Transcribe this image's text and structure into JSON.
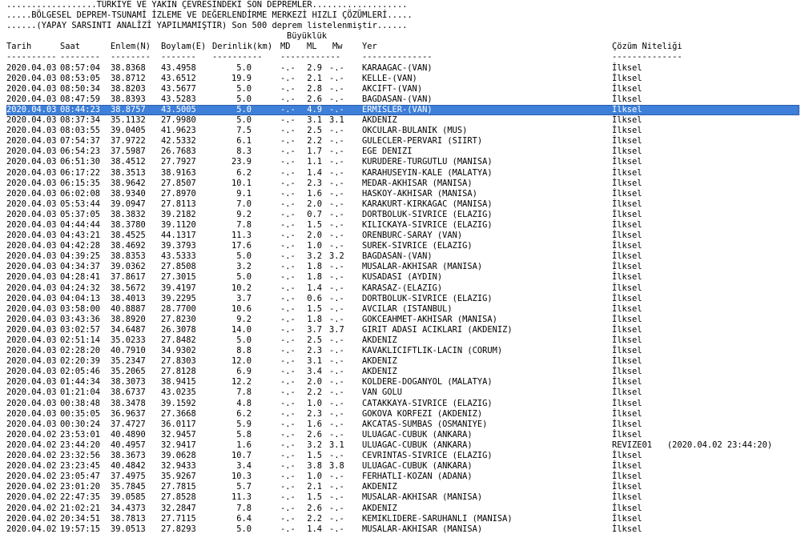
{
  "header": {
    "line1": "..................TÜRKİYE VE YAKIN ÇEVRESİNDEKİ SON DEPREMLER...................",
    "line2": ".....BÖLGESEL DEPREM-TSUNAMİ İZLEME VE DEĞERLENDİRME MERKEZİ HIZLI ÇÖZÜMLERİ.....",
    "line3": "......(YAPAY SARSINTI ANALİZİ YAPILMAMIŞTIR) Son 500 deprem listelenmiştir......",
    "magnitude_group": "Büyüklük"
  },
  "columns": {
    "date": "Tarih",
    "time": "Saat",
    "lat": "Enlem(N)",
    "lon": "Boylam(E)",
    "depth": "Derinlik(km)",
    "md": "MD",
    "ml": "ML",
    "mw": "Mw",
    "place": "Yer",
    "solution": "Çözüm Niteliği"
  },
  "rulers": {
    "date": "----------",
    "time": "--------",
    "lat": "--------",
    "lon": "-------",
    "depth": "----------",
    "mag": "------------",
    "place": "--------------",
    "solution": "--------------"
  },
  "rows": [
    {
      "date": "2020.04.03",
      "time": "08:57:04",
      "lat": "38.8368",
      "lon": "43.4958",
      "depth": "5.0",
      "md": "-.-",
      "ml": "2.9",
      "mw": "-.-",
      "place": "KARAAGAC-(VAN)",
      "solution": "İlksel"
    },
    {
      "date": "2020.04.03",
      "time": "08:53:05",
      "lat": "38.8712",
      "lon": "43.6512",
      "depth": "19.9",
      "md": "-.-",
      "ml": "2.1",
      "mw": "-.-",
      "place": "KELLE-(VAN)",
      "solution": "İlksel"
    },
    {
      "date": "2020.04.03",
      "time": "08:50:34",
      "lat": "38.8203",
      "lon": "43.5677",
      "depth": "5.0",
      "md": "-.-",
      "ml": "2.8",
      "mw": "-.-",
      "place": "AKCIFT-(VAN)",
      "solution": "İlksel"
    },
    {
      "date": "2020.04.03",
      "time": "08:47:59",
      "lat": "38.8393",
      "lon": "43.5283",
      "depth": "5.0",
      "md": "-.-",
      "ml": "2.6",
      "mw": "-.-",
      "place": "BAGDASAN-(VAN)",
      "solution": "İlksel"
    },
    {
      "date": "2020.04.03",
      "time": "08:44:23",
      "lat": "38.8757",
      "lon": "43.5005",
      "depth": "5.0",
      "md": "-.-",
      "ml": "4.9",
      "mw": "-.-",
      "place": "ERMISLER-(VAN)",
      "solution": "İlksel",
      "selected": true
    },
    {
      "date": "2020.04.03",
      "time": "08:37:34",
      "lat": "35.1132",
      "lon": "27.9980",
      "depth": "5.0",
      "md": "-.-",
      "ml": "3.1",
      "mw": "3.1",
      "place": "AKDENIZ",
      "solution": "İlksel"
    },
    {
      "date": "2020.04.03",
      "time": "08:03:55",
      "lat": "39.0405",
      "lon": "41.9623",
      "depth": "7.5",
      "md": "-.-",
      "ml": "2.5",
      "mw": "-.-",
      "place": "OKCULAR-BULANIK (MUS)",
      "solution": "İlksel"
    },
    {
      "date": "2020.04.03",
      "time": "07:54:37",
      "lat": "37.9722",
      "lon": "42.5332",
      "depth": "6.1",
      "md": "-.-",
      "ml": "2.2",
      "mw": "-.-",
      "place": "GULECLER-PERVARI (SIIRT)",
      "solution": "İlksel"
    },
    {
      "date": "2020.04.03",
      "time": "06:54:23",
      "lat": "37.5987",
      "lon": "26.7683",
      "depth": "8.3",
      "md": "-.-",
      "ml": "1.7",
      "mw": "-.-",
      "place": "EGE DENIZI",
      "solution": "İlksel"
    },
    {
      "date": "2020.04.03",
      "time": "06:51:30",
      "lat": "38.4512",
      "lon": "27.7927",
      "depth": "23.9",
      "md": "-.-",
      "ml": "1.1",
      "mw": "-.-",
      "place": "KURUDERE-TURGUTLU (MANISA)",
      "solution": "İlksel"
    },
    {
      "date": "2020.04.03",
      "time": "06:17:22",
      "lat": "38.3513",
      "lon": "38.9163",
      "depth": "6.2",
      "md": "-.-",
      "ml": "1.4",
      "mw": "-.-",
      "place": "KARAHUSEYIN-KALE (MALATYA)",
      "solution": "İlksel"
    },
    {
      "date": "2020.04.03",
      "time": "06:15:35",
      "lat": "38.9642",
      "lon": "27.8507",
      "depth": "10.1",
      "md": "-.-",
      "ml": "2.3",
      "mw": "-.-",
      "place": "MEDAR-AKHISAR (MANISA)",
      "solution": "İlksel"
    },
    {
      "date": "2020.04.03",
      "time": "06:02:08",
      "lat": "38.9340",
      "lon": "27.8970",
      "depth": "9.1",
      "md": "-.-",
      "ml": "1.6",
      "mw": "-.-",
      "place": "HASKOY-AKHISAR (MANISA)",
      "solution": "İlksel"
    },
    {
      "date": "2020.04.03",
      "time": "05:53:44",
      "lat": "39.0947",
      "lon": "27.8113",
      "depth": "7.0",
      "md": "-.-",
      "ml": "2.0",
      "mw": "-.-",
      "place": "KARAKURT-KIRKAGAC (MANISA)",
      "solution": "İlksel"
    },
    {
      "date": "2020.04.03",
      "time": "05:37:05",
      "lat": "38.3832",
      "lon": "39.2182",
      "depth": "9.2",
      "md": "-.-",
      "ml": "0.7",
      "mw": "-.-",
      "place": "DORTBOLUK-SIVRICE (ELAZIG)",
      "solution": "İlksel"
    },
    {
      "date": "2020.04.03",
      "time": "04:44:44",
      "lat": "38.3780",
      "lon": "39.1120",
      "depth": "7.8",
      "md": "-.-",
      "ml": "1.5",
      "mw": "-.-",
      "place": "KILICKAYA-SIVRICE (ELAZIG)",
      "solution": "İlksel"
    },
    {
      "date": "2020.04.03",
      "time": "04:43:21",
      "lat": "38.4525",
      "lon": "44.1317",
      "depth": "11.3",
      "md": "-.-",
      "ml": "2.0",
      "mw": "-.-",
      "place": "ORENBURC-SARAY (VAN)",
      "solution": "İlksel"
    },
    {
      "date": "2020.04.03",
      "time": "04:42:28",
      "lat": "38.4692",
      "lon": "39.3793",
      "depth": "17.6",
      "md": "-.-",
      "ml": "1.0",
      "mw": "-.-",
      "place": "SUREK-SIVRICE (ELAZIG)",
      "solution": "İlksel"
    },
    {
      "date": "2020.04.03",
      "time": "04:39:25",
      "lat": "38.8353",
      "lon": "43.5333",
      "depth": "5.0",
      "md": "-.-",
      "ml": "3.2",
      "mw": "3.2",
      "place": "BAGDASAN-(VAN)",
      "solution": "İlksel"
    },
    {
      "date": "2020.04.03",
      "time": "04:34:37",
      "lat": "39.0362",
      "lon": "27.8508",
      "depth": "3.2",
      "md": "-.-",
      "ml": "1.8",
      "mw": "-.-",
      "place": "MUSALAR-AKHISAR (MANISA)",
      "solution": "İlksel"
    },
    {
      "date": "2020.04.03",
      "time": "04:28:41",
      "lat": "37.8617",
      "lon": "27.3015",
      "depth": "5.0",
      "md": "-.-",
      "ml": "1.8",
      "mw": "-.-",
      "place": "KUSADASI (AYDIN)",
      "solution": "İlksel"
    },
    {
      "date": "2020.04.03",
      "time": "04:24:32",
      "lat": "38.5672",
      "lon": "39.4197",
      "depth": "10.2",
      "md": "-.-",
      "ml": "1.4",
      "mw": "-.-",
      "place": "KARASAZ-(ELAZIG)",
      "solution": "İlksel"
    },
    {
      "date": "2020.04.03",
      "time": "04:04:13",
      "lat": "38.4013",
      "lon": "39.2295",
      "depth": "3.7",
      "md": "-.-",
      "ml": "0.6",
      "mw": "-.-",
      "place": "DORTBOLUK-SIVRICE (ELAZIG)",
      "solution": "İlksel"
    },
    {
      "date": "2020.04.03",
      "time": "03:58:00",
      "lat": "40.8887",
      "lon": "28.7700",
      "depth": "10.6",
      "md": "-.-",
      "ml": "1.5",
      "mw": "-.-",
      "place": "AVCILAR (ISTANBUL)",
      "solution": "İlksel"
    },
    {
      "date": "2020.04.03",
      "time": "03:43:36",
      "lat": "38.8920",
      "lon": "27.8230",
      "depth": "9.2",
      "md": "-.-",
      "ml": "1.8",
      "mw": "-.-",
      "place": "GOKCEAHMET-AKHISAR (MANISA)",
      "solution": "İlksel"
    },
    {
      "date": "2020.04.03",
      "time": "03:02:57",
      "lat": "34.6487",
      "lon": "26.3078",
      "depth": "14.0",
      "md": "-.-",
      "ml": "3.7",
      "mw": "3.7",
      "place": "GIRIT ADASI ACIKLARI (AKDENIZ)",
      "solution": "İlksel"
    },
    {
      "date": "2020.04.03",
      "time": "02:51:14",
      "lat": "35.0233",
      "lon": "27.8482",
      "depth": "5.0",
      "md": "-.-",
      "ml": "2.5",
      "mw": "-.-",
      "place": "AKDENIZ",
      "solution": "İlksel"
    },
    {
      "date": "2020.04.03",
      "time": "02:28:20",
      "lat": "40.7910",
      "lon": "34.9302",
      "depth": "8.8",
      "md": "-.-",
      "ml": "2.3",
      "mw": "-.-",
      "place": "KAVAKLICIFTLIK-LACIN (CORUM)",
      "solution": "İlksel"
    },
    {
      "date": "2020.04.03",
      "time": "02:20:39",
      "lat": "35.2347",
      "lon": "27.8303",
      "depth": "12.0",
      "md": "-.-",
      "ml": "3.1",
      "mw": "-.-",
      "place": "AKDENIZ",
      "solution": "İlksel"
    },
    {
      "date": "2020.04.03",
      "time": "02:05:46",
      "lat": "35.2065",
      "lon": "27.8128",
      "depth": "6.9",
      "md": "-.-",
      "ml": "3.4",
      "mw": "-.-",
      "place": "AKDENIZ",
      "solution": "İlksel"
    },
    {
      "date": "2020.04.03",
      "time": "01:44:34",
      "lat": "38.3073",
      "lon": "38.9415",
      "depth": "12.2",
      "md": "-.-",
      "ml": "2.0",
      "mw": "-.-",
      "place": "KOLDERE-DOGANYOL (MALATYA)",
      "solution": "İlksel"
    },
    {
      "date": "2020.04.03",
      "time": "01:21:04",
      "lat": "38.6737",
      "lon": "43.0235",
      "depth": "7.8",
      "md": "-.-",
      "ml": "2.2",
      "mw": "-.-",
      "place": "VAN GOLU",
      "solution": "İlksel"
    },
    {
      "date": "2020.04.03",
      "time": "00:38:48",
      "lat": "38.3478",
      "lon": "39.1592",
      "depth": "4.8",
      "md": "-.-",
      "ml": "1.0",
      "mw": "-.-",
      "place": "CATAKKAYA-SIVRICE (ELAZIG)",
      "solution": "İlksel"
    },
    {
      "date": "2020.04.03",
      "time": "00:35:05",
      "lat": "36.9637",
      "lon": "27.3668",
      "depth": "6.2",
      "md": "-.-",
      "ml": "2.3",
      "mw": "-.-",
      "place": "GOKOVA KORFEZI (AKDENIZ)",
      "solution": "İlksel"
    },
    {
      "date": "2020.04.03",
      "time": "00:30:24",
      "lat": "37.4727",
      "lon": "36.0117",
      "depth": "5.9",
      "md": "-.-",
      "ml": "1.6",
      "mw": "-.-",
      "place": "AKCATAS-SUMBAS (OSMANIYE)",
      "solution": "İlksel"
    },
    {
      "date": "2020.04.02",
      "time": "23:53:01",
      "lat": "40.4890",
      "lon": "32.9457",
      "depth": "5.8",
      "md": "-.-",
      "ml": "2.6",
      "mw": "-.-",
      "place": "ULUAGAC-CUBUK (ANKARA)",
      "solution": "İlksel"
    },
    {
      "date": "2020.04.02",
      "time": "23:44:20",
      "lat": "40.4957",
      "lon": "32.9417",
      "depth": "1.6",
      "md": "-.-",
      "ml": "3.2",
      "mw": "3.1",
      "place": "ULUAGAC-CUBUK (ANKARA)",
      "solution": "REVIZE01   (2020.04.02 23:44:20)"
    },
    {
      "date": "2020.04.02",
      "time": "23:32:56",
      "lat": "38.3673",
      "lon": "39.0628",
      "depth": "10.7",
      "md": "-.-",
      "ml": "1.5",
      "mw": "-.-",
      "place": "CEVRINTAS-SIVRICE (ELAZIG)",
      "solution": "İlksel"
    },
    {
      "date": "2020.04.02",
      "time": "23:23:45",
      "lat": "40.4842",
      "lon": "32.9433",
      "depth": "3.4",
      "md": "-.-",
      "ml": "3.8",
      "mw": "3.8",
      "place": "ULUAGAC-CUBUK (ANKARA)",
      "solution": "İlksel"
    },
    {
      "date": "2020.04.02",
      "time": "23:05:47",
      "lat": "37.4975",
      "lon": "35.9267",
      "depth": "10.3",
      "md": "-.-",
      "ml": "1.0",
      "mw": "-.-",
      "place": "FERHATLI-KOZAN (ADANA)",
      "solution": "İlksel"
    },
    {
      "date": "2020.04.02",
      "time": "23:01:20",
      "lat": "35.7845",
      "lon": "27.7815",
      "depth": "5.7",
      "md": "-.-",
      "ml": "2.1",
      "mw": "-.-",
      "place": "AKDENIZ",
      "solution": "İlksel"
    },
    {
      "date": "2020.04.02",
      "time": "22:47:35",
      "lat": "39.0585",
      "lon": "27.8528",
      "depth": "11.3",
      "md": "-.-",
      "ml": "1.5",
      "mw": "-.-",
      "place": "MUSALAR-AKHISAR (MANISA)",
      "solution": "İlksel"
    },
    {
      "date": "2020.04.02",
      "time": "21:02:21",
      "lat": "34.4373",
      "lon": "32.2847",
      "depth": "7.8",
      "md": "-.-",
      "ml": "2.6",
      "mw": "-.-",
      "place": "AKDENIZ",
      "solution": "İlksel"
    },
    {
      "date": "2020.04.02",
      "time": "20:34:51",
      "lat": "38.7813",
      "lon": "27.7115",
      "depth": "6.4",
      "md": "-.-",
      "ml": "2.2",
      "mw": "-.-",
      "place": "KEMIKLIDERE-SARUHANLI (MANISA)",
      "solution": "İlksel"
    },
    {
      "date": "2020.04.02",
      "time": "19:57:15",
      "lat": "39.0513",
      "lon": "27.8293",
      "depth": "5.0",
      "md": "-.-",
      "ml": "1.4",
      "mw": "-.-",
      "place": "MUSALAR-AKHISAR (MANISA)",
      "solution": "İlksel"
    }
  ]
}
